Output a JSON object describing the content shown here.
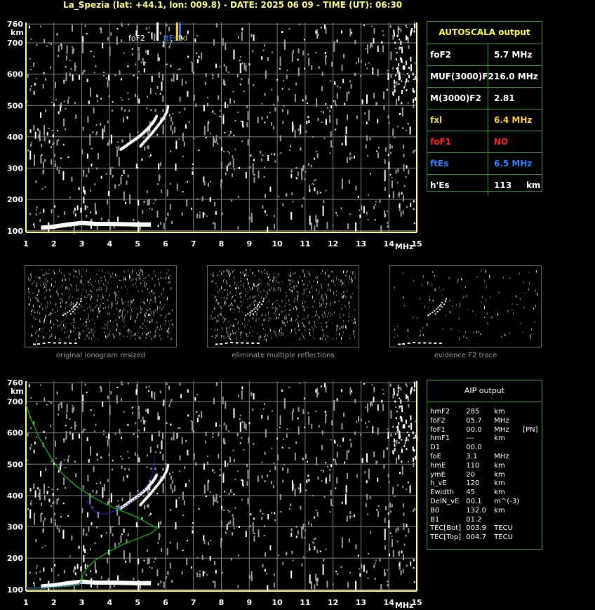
{
  "title": "La_Spezia (lat: +44.1, lon: 009.8) - DATE: 2025 06 09 - TIME (UT): 06:30",
  "colors": {
    "axis": "#ffff80",
    "grid": "#808080",
    "panel_border": "#2f9a2f",
    "model_profile": "#00c800",
    "trace_fit": "#2030ff",
    "foF1": "#ff2020",
    "ftEs": "#3080ff",
    "fxl": "#ffd040"
  },
  "top_chart": {
    "chart_data": {
      "type": "scatter",
      "xlabel": "MHz",
      "ylabel": "km",
      "xlim": [
        1,
        15
      ],
      "ylim": [
        95,
        765
      ],
      "x_ticks": [
        1,
        2,
        3,
        4,
        5,
        6,
        7,
        8,
        9,
        10,
        11,
        12,
        13,
        14,
        15
      ],
      "y_ticks": [
        100,
        200,
        300,
        400,
        500,
        600,
        700,
        760
      ],
      "markers": [
        {
          "label": "foF2",
          "x": 5.7
        },
        {
          "label": "ftEs",
          "x": 6.5
        },
        {
          "label": "fxl",
          "x": 6.4
        }
      ],
      "traces": [
        {
          "name": "o",
          "points": [
            [
              4.4,
              360
            ],
            [
              4.6,
              372
            ],
            [
              4.8,
              385
            ],
            [
              5.0,
              397
            ],
            [
              5.2,
              412
            ],
            [
              5.35,
              425
            ],
            [
              5.5,
              440
            ],
            [
              5.6,
              452
            ],
            [
              5.7,
              468
            ]
          ]
        },
        {
          "name": "x",
          "points": [
            [
              5.1,
              370
            ],
            [
              5.3,
              390
            ],
            [
              5.5,
              410
            ],
            [
              5.7,
              432
            ],
            [
              5.9,
              455
            ],
            [
              6.05,
              480
            ],
            [
              6.1,
              500
            ]
          ]
        },
        {
          "name": "Es",
          "points": [
            [
              1.6,
              110
            ],
            [
              2.0,
              113
            ],
            [
              2.5,
              120
            ],
            [
              3.0,
              125
            ],
            [
              3.5,
              122
            ],
            [
              4.0,
              122
            ],
            [
              4.5,
              121
            ],
            [
              5.0,
              120
            ],
            [
              5.5,
              120
            ]
          ]
        }
      ]
    }
  },
  "bottom_chart": {
    "chart_data": {
      "type": "line",
      "xlabel": "MHz",
      "ylabel": "km",
      "xlim": [
        1,
        15
      ],
      "ylim": [
        95,
        765
      ],
      "x_ticks": [
        1,
        2,
        3,
        4,
        5,
        6,
        7,
        8,
        9,
        10,
        11,
        12,
        13,
        14,
        15
      ],
      "y_ticks": [
        100,
        200,
        300,
        400,
        500,
        600,
        700,
        760
      ],
      "series": [
        {
          "points": [
            [
              1.0,
              690
            ],
            [
              1.2,
              640
            ],
            [
              1.5,
              580
            ],
            [
              1.9,
              520
            ],
            [
              2.3,
              470
            ],
            [
              2.8,
              430
            ],
            [
              3.3,
              400
            ],
            [
              3.8,
              375
            ],
            [
              4.3,
              355
            ],
            [
              4.8,
              338
            ],
            [
              5.2,
              320
            ],
            [
              5.5,
              305
            ],
            [
              5.7,
              296
            ],
            [
              5.5,
              280
            ],
            [
              5.0,
              262
            ],
            [
              4.5,
              245
            ],
            [
              4.0,
              222
            ],
            [
              3.5,
              195
            ],
            [
              3.2,
              170
            ],
            [
              3.05,
              150
            ],
            [
              3.0,
              130
            ],
            [
              2.9,
              115
            ],
            [
              2.5,
              110
            ],
            [
              2.0,
              107
            ],
            [
              1.5,
              105
            ],
            [
              1.0,
              104
            ]
          ]
        },
        {
          "points": [
            [
              3.2,
              380
            ],
            [
              3.5,
              345
            ],
            [
              3.8,
              340
            ],
            [
              4.2,
              352
            ],
            [
              4.6,
              370
            ],
            [
              5.0,
              395
            ],
            [
              5.3,
              425
            ],
            [
              5.5,
              460
            ],
            [
              5.6,
              500
            ],
            [
              5.6,
              530
            ]
          ]
        },
        {
          "points": [
            [
              1.0,
              104
            ],
            [
              1.5,
              106
            ],
            [
              2.0,
              108
            ],
            [
              2.5,
              112
            ],
            [
              2.9,
              118
            ],
            [
              3.0,
              125
            ]
          ]
        }
      ],
      "traces": [
        {
          "name": "o",
          "points": [
            [
              4.4,
              360
            ],
            [
              4.6,
              372
            ],
            [
              4.8,
              385
            ],
            [
              5.0,
              397
            ],
            [
              5.2,
              412
            ],
            [
              5.35,
              425
            ],
            [
              5.5,
              440
            ],
            [
              5.6,
              452
            ],
            [
              5.7,
              468
            ]
          ]
        },
        {
          "name": "x",
          "points": [
            [
              5.1,
              370
            ],
            [
              5.3,
              390
            ],
            [
              5.5,
              410
            ],
            [
              5.7,
              432
            ],
            [
              5.9,
              455
            ],
            [
              6.05,
              480
            ],
            [
              6.1,
              500
            ]
          ]
        },
        {
          "name": "Es",
          "points": [
            [
              1.6,
              110
            ],
            [
              2.0,
              113
            ],
            [
              2.5,
              120
            ],
            [
              3.0,
              125
            ],
            [
              3.5,
              122
            ],
            [
              4.0,
              122
            ],
            [
              4.5,
              121
            ],
            [
              5.0,
              120
            ],
            [
              5.5,
              120
            ]
          ]
        }
      ]
    }
  },
  "autoscala": {
    "title": "AUTOSCALA output",
    "rows": [
      {
        "key": "foF2",
        "value": "5.7 MHz",
        "color": "#ffffff"
      },
      {
        "key": "MUF(3000)F2",
        "value": "16.0 MHz",
        "color": "#ffffff"
      },
      {
        "key": "M(3000)F2",
        "value": "2.81",
        "color": "#ffffff"
      },
      {
        "key": "fxl",
        "value": "6.4 MHz",
        "color": "#ffd040"
      },
      {
        "key": "foF1",
        "value": "NO",
        "color": "#ff2020"
      },
      {
        "key": "ftEs",
        "value": "6.5 MHz",
        "color": "#3080ff"
      },
      {
        "key": "h'Es",
        "value": "113     km",
        "color": "#ffffff"
      }
    ]
  },
  "aip": {
    "title": "AIP output",
    "rows": [
      [
        "hmF2",
        "285",
        "km",
        ""
      ],
      [
        "foF2",
        "05.7",
        "MHz",
        ""
      ],
      [
        "foF1",
        "00.0",
        "MHz",
        "[PN]"
      ],
      [
        "hmF1",
        "---",
        "km",
        ""
      ],
      [
        "D1",
        "00.0",
        "",
        ""
      ],
      [
        "foE",
        "3.1",
        "MHz",
        ""
      ],
      [
        "hmE",
        "110",
        "km",
        ""
      ],
      [
        "ymE",
        "20",
        "km",
        ""
      ],
      [
        "h_vE",
        "120",
        "km",
        ""
      ],
      [
        "Ewidth",
        "45",
        "km",
        ""
      ],
      [
        "DelN_vE",
        "00.1",
        "m^(-3)",
        ""
      ],
      [
        "B0",
        "132.0",
        "km",
        ""
      ],
      [
        "B1",
        "01.2",
        "",
        ""
      ],
      [
        "TEC[Bot]",
        "003.9",
        "TECU",
        ""
      ],
      [
        "TEC[Top]",
        "004.7",
        "TECU",
        ""
      ]
    ]
  },
  "thumbnails": [
    {
      "caption": "original ionogram resized"
    },
    {
      "caption": "eliminate multiple reflections"
    },
    {
      "caption": "evidence F2 trace"
    }
  ]
}
